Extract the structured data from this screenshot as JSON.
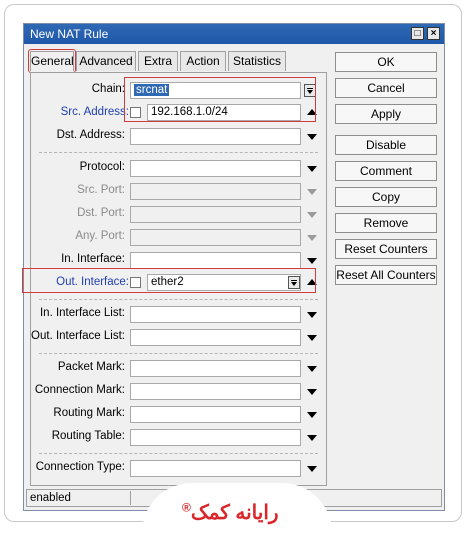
{
  "window": {
    "title": "New NAT Rule"
  },
  "tabs": [
    "General",
    "Advanced",
    "Extra",
    "Action",
    "Statistics"
  ],
  "fields": {
    "chain": {
      "label": "Chain:",
      "value": "srcnat"
    },
    "src_address": {
      "label": "Src. Address:",
      "value": "192.168.1.0/24"
    },
    "dst_address": {
      "label": "Dst. Address:",
      "value": ""
    },
    "protocol": {
      "label": "Protocol:",
      "value": ""
    },
    "src_port": {
      "label": "Src. Port:",
      "value": ""
    },
    "dst_port": {
      "label": "Dst. Port:",
      "value": ""
    },
    "any_port": {
      "label": "Any. Port:",
      "value": ""
    },
    "in_interface": {
      "label": "In. Interface:",
      "value": ""
    },
    "out_interface": {
      "label": "Out. Interface:",
      "value": "ether2"
    },
    "in_interface_list": {
      "label": "In. Interface List:",
      "value": ""
    },
    "out_interface_list": {
      "label": "Out. Interface List:",
      "value": ""
    },
    "packet_mark": {
      "label": "Packet Mark:",
      "value": ""
    },
    "connection_mark": {
      "label": "Connection Mark:",
      "value": ""
    },
    "routing_mark": {
      "label": "Routing Mark:",
      "value": ""
    },
    "routing_table": {
      "label": "Routing Table:",
      "value": ""
    },
    "connection_type": {
      "label": "Connection Type:",
      "value": ""
    }
  },
  "buttons": [
    "OK",
    "Cancel",
    "Apply",
    "Disable",
    "Comment",
    "Copy",
    "Remove",
    "Reset Counters",
    "Reset All Counters"
  ],
  "status": {
    "text": "enabled"
  },
  "watermark": {
    "text": "رایانه کمک",
    "reg": "®"
  },
  "colors": {
    "titlebar": "#2f68b3",
    "highlight": "#cf3c3c",
    "label_blue": "#1f3fb0"
  }
}
